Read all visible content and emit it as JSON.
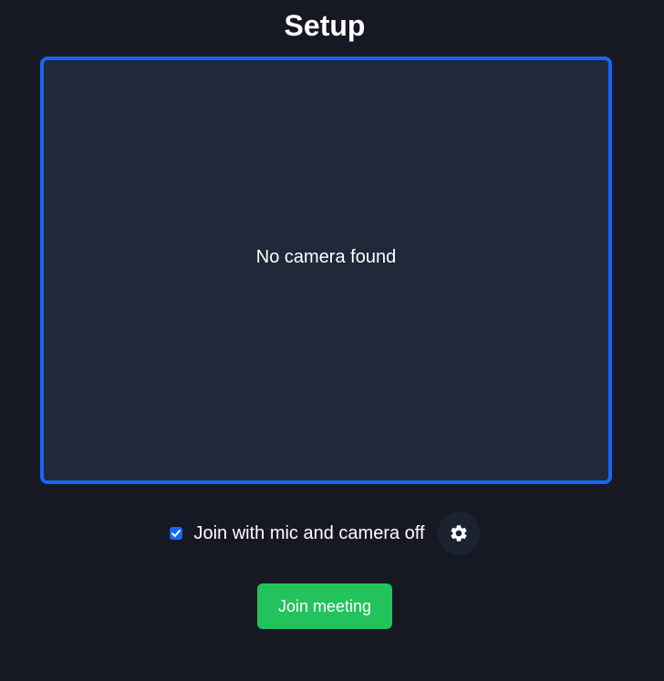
{
  "page": {
    "title": "Setup"
  },
  "preview": {
    "message": "No camera found"
  },
  "options": {
    "join_muted_label": "Join with mic and camera off",
    "join_muted_checked": true,
    "settings_icon": "gear-icon"
  },
  "actions": {
    "join_label": "Join meeting"
  },
  "colors": {
    "background": "#161824",
    "preview_bg": "#1f293a",
    "preview_border": "#1766f5",
    "join_button": "#22c35d",
    "settings_button_bg": "#1c2330"
  }
}
